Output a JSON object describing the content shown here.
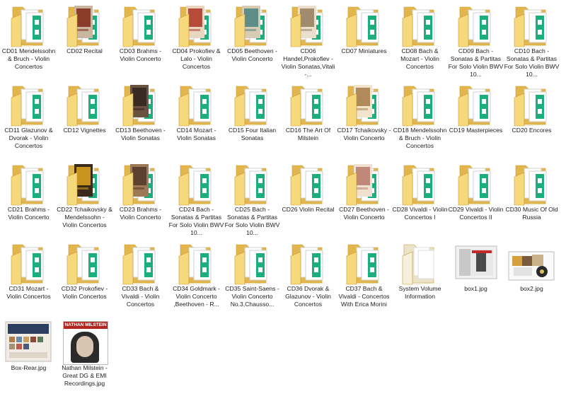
{
  "window": {
    "view": "large-icons",
    "item_count": 43
  },
  "colors": {
    "folder_back": "#e2b64c",
    "folder_front": "#f7d97d",
    "folder_edge": "#c99a2e",
    "doc_accent": "#1cae7e",
    "doc_white": "#ffffff"
  },
  "items": [
    {
      "name": "CD01 Mendelssohn & Bruch - Violin Concertos",
      "kind": "folder",
      "cover": "none"
    },
    {
      "name": "CD02 Recital",
      "kind": "folder",
      "cover": "photo-dark-red"
    },
    {
      "name": "CD03 Brahms - Violin Concerto",
      "kind": "folder",
      "cover": "none"
    },
    {
      "name": "CD04 Prokofiev & Lalo - Violin Concertos",
      "kind": "folder",
      "cover": "photo-red"
    },
    {
      "name": "CD05 Beethoven - Violin Concerto",
      "kind": "folder",
      "cover": "photo-teal"
    },
    {
      "name": "CD06 Handel,Prokofiev - Violin Sonatas,Vitali -...",
      "kind": "folder",
      "cover": "photo-beige"
    },
    {
      "name": "CD07 Miniatures",
      "kind": "folder",
      "cover": "none"
    },
    {
      "name": "CD08 Bach & Mozart - Violin Concertos",
      "kind": "folder",
      "cover": "none"
    },
    {
      "name": "CD09 Bach - Sonatas & Partitas For Solo Violin BWV 10...",
      "kind": "folder",
      "cover": "none"
    },
    {
      "name": "CD10 Bach - Sonatas & Partitas For Solo Violin BWV 10...",
      "kind": "folder",
      "cover": "none"
    },
    {
      "name": "CD11 Glazunov & Dvorak - Violin Concertos",
      "kind": "folder",
      "cover": "none"
    },
    {
      "name": "CD12 Vignettes",
      "kind": "folder",
      "cover": "none"
    },
    {
      "name": "CD13 Beethoven - Violin Sonatas",
      "kind": "folder",
      "cover": "photo-dark"
    },
    {
      "name": "CD14 Mozart - Violin Sonatas",
      "kind": "folder",
      "cover": "none"
    },
    {
      "name": "CD15 Four Italian Sonatas",
      "kind": "folder",
      "cover": "none"
    },
    {
      "name": "CD16 The Art Of Milstein",
      "kind": "folder",
      "cover": "none"
    },
    {
      "name": "CD17 Tchaikovsky - Violin Concerto",
      "kind": "folder",
      "cover": "photo-tan"
    },
    {
      "name": "CD18 Mendelssohn & Bruch - Violin Concertos",
      "kind": "folder",
      "cover": "none"
    },
    {
      "name": "CD19 Masterpieces",
      "kind": "folder",
      "cover": "none"
    },
    {
      "name": "CD20 Encores",
      "kind": "folder",
      "cover": "none"
    },
    {
      "name": "CD21 Brahms - Violin Concerto",
      "kind": "folder",
      "cover": "none"
    },
    {
      "name": "CD22 Tchaikovsky & Mendelssohn - Violin Concertos",
      "kind": "folder",
      "cover": "photo-gold"
    },
    {
      "name": "CD23 Brahms - Violin Concerto",
      "kind": "folder",
      "cover": "photo-brown"
    },
    {
      "name": "CD24 Bach - Sonatas & Partitas For Solo Violin BWV 10...",
      "kind": "folder",
      "cover": "none"
    },
    {
      "name": "CD25 Bach - Sonatas & Partitas For Solo Violin BWV 10...",
      "kind": "folder",
      "cover": "none"
    },
    {
      "name": "CD26 Violin Recital",
      "kind": "folder",
      "cover": "none"
    },
    {
      "name": "CD27 Beethoven - Violin Concerto",
      "kind": "folder",
      "cover": "photo-rose"
    },
    {
      "name": "CD28 Vivaldi - Violin Concertos I",
      "kind": "folder",
      "cover": "none"
    },
    {
      "name": "CD29 Vivaldi - Violin Concertos II",
      "kind": "folder",
      "cover": "none"
    },
    {
      "name": "CD30 Music Of Old Russia",
      "kind": "folder",
      "cover": "none"
    },
    {
      "name": "CD31 Mozart - Violin Concertos",
      "kind": "folder",
      "cover": "none"
    },
    {
      "name": "CD32 Prokofiev - Violin Concertos",
      "kind": "folder",
      "cover": "none"
    },
    {
      "name": "CD33 Bach & Vivaldi - Violin Concertos",
      "kind": "folder",
      "cover": "none"
    },
    {
      "name": "CD34 Goldmark - Violin Concerto ,Beethoven - R...",
      "kind": "folder",
      "cover": "none"
    },
    {
      "name": "CD35 Saint-Saens - Violin Concerto No.3,Chausso...",
      "kind": "folder",
      "cover": "none"
    },
    {
      "name": "CD36 Dvorak & Glazunov - Violin Concertos",
      "kind": "folder",
      "cover": "none"
    },
    {
      "name": "CD37 Bach & Vivaldi - Concertos With Erica Morini",
      "kind": "folder",
      "cover": "none"
    },
    {
      "name": "System Volume Information",
      "kind": "system-folder",
      "cover": "none"
    },
    {
      "name": "box1.jpg",
      "kind": "image",
      "thumb": "box1"
    },
    {
      "name": "box2.jpg",
      "kind": "image",
      "thumb": "box2"
    },
    {
      "name": "Box-Rear.jpg",
      "kind": "image",
      "thumb": "rear"
    },
    {
      "name": "Nathan Milstein - Great DG & EMI Recordings.jpg",
      "kind": "image",
      "thumb": "cover",
      "thumb_text": "NATHAN MILSTEIN"
    }
  ]
}
